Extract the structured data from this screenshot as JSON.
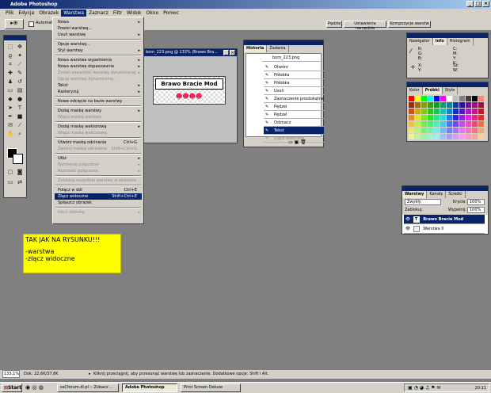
{
  "app": {
    "title": "Adobe Photoshop"
  },
  "menubar": [
    "Plik",
    "Edycja",
    "Obrazek",
    "Warstwa",
    "Zaznacz",
    "Filtr",
    "Widok",
    "Okno",
    "Pomoc"
  ],
  "options": {
    "auto_label": "Automaty",
    "palette_buttons": [
      "Pędzle",
      "Ustawienia narzędzia",
      "Kompozycje warstw"
    ]
  },
  "menu": [
    {
      "label": "Nowa",
      "arrow": "▸",
      "state": "normal"
    },
    {
      "label": "Powiel warstwę...",
      "state": "normal"
    },
    {
      "label": "Usuń warstwę",
      "arrow": "▸",
      "state": "normal"
    },
    {
      "sep": true
    },
    {
      "label": "Opcje warstwy...",
      "state": "normal"
    },
    {
      "label": "Styl warstwy",
      "arrow": "▸",
      "state": "normal"
    },
    {
      "sep": true
    },
    {
      "label": "Nowa warstwa wypełnienia",
      "arrow": "▸",
      "state": "normal"
    },
    {
      "label": "Nowa warstwa dopasowania",
      "arrow": "▸",
      "state": "normal"
    },
    {
      "label": "Zmień zawartość warstwy dynamicznej",
      "arrow": "▸",
      "state": "disabled"
    },
    {
      "label": "Opcje warstwy dynamicznej...",
      "state": "disabled"
    },
    {
      "label": "Tekst",
      "arrow": "▸",
      "state": "normal"
    },
    {
      "label": "Rasteryzuj",
      "arrow": "▸",
      "state": "normal"
    },
    {
      "sep": true
    },
    {
      "label": "Nowe odcięcie na bazie warstwy",
      "state": "normal"
    },
    {
      "sep": true
    },
    {
      "label": "Dodaj maskę warstwy",
      "arrow": "▸",
      "state": "normal"
    },
    {
      "label": "Włącz maskę warstwy",
      "state": "disabled"
    },
    {
      "sep": true
    },
    {
      "label": "Dodaj maskę wektorową",
      "arrow": "▸",
      "state": "normal"
    },
    {
      "label": "Włącz maskę wektorową",
      "state": "disabled"
    },
    {
      "sep": true
    },
    {
      "label": "Utwórz maskę odcinania",
      "shortcut": "Ctrl+G",
      "state": "normal"
    },
    {
      "label": "Zwolnij maskę odcinania",
      "shortcut": "Shift+Ctrl+G",
      "state": "disabled"
    },
    {
      "sep": true
    },
    {
      "label": "Ułóż",
      "arrow": "▸",
      "state": "normal"
    },
    {
      "label": "Wyrównaj połączone",
      "arrow": "▸",
      "state": "disabled"
    },
    {
      "label": "Rozmieść połączone",
      "arrow": "▸",
      "state": "disabled"
    },
    {
      "sep": true
    },
    {
      "label": "Zablokuj wszystkie warstwy w zestawie...",
      "state": "disabled"
    },
    {
      "sep": true
    },
    {
      "label": "Połącz w dół",
      "shortcut": "Ctrl+E",
      "state": "normal"
    },
    {
      "label": "Złącz widoczne",
      "shortcut": "Shift+Ctrl+E",
      "state": "highlight"
    },
    {
      "label": "Spłaszcz obrazek",
      "state": "normal"
    },
    {
      "sep": true
    },
    {
      "label": "Usuń otoczkę",
      "arrow": "▸",
      "state": "disabled"
    }
  ],
  "document": {
    "title": "bom_223.png @ 133% (Brawo Bra...",
    "banner": "Brawo Bracie Mod"
  },
  "history": {
    "tabs": [
      "Historia",
      "Zadania"
    ],
    "snapshot": "bom_223.png",
    "rows": [
      {
        "label": "Otwórz",
        "state": "normal"
      },
      {
        "label": "Półobka",
        "state": "normal"
      },
      {
        "label": "Półobka",
        "state": "normal"
      },
      {
        "label": "Usuń",
        "state": "normal"
      },
      {
        "label": "Zaznaczenie prostokątne",
        "state": "normal"
      },
      {
        "label": "Pędzel",
        "state": "normal"
      },
      {
        "label": "Pędzel",
        "state": "normal"
      },
      {
        "label": "Odznacz",
        "state": "normal"
      },
      {
        "label": "Tekst",
        "state": "selected"
      },
      {
        "label": "Złącz widoczne",
        "state": "disabled"
      }
    ]
  },
  "navigator": {
    "tabs": [
      "Nawigator",
      "Info",
      "Histogram"
    ],
    "labels": [
      "R:",
      "G:",
      "B:",
      "C:",
      "M:",
      "Y:",
      "K:",
      "X:",
      "Y:",
      "Sz:",
      "W:"
    ]
  },
  "swatches": {
    "tabs": [
      "Kolor",
      "Próbki",
      "Style"
    ]
  },
  "layers": {
    "tabs": [
      "Warstwy",
      "Kanały",
      "Ścieżki"
    ],
    "blend": "Zwykły",
    "opacity_label": "Krycie:",
    "opacity": "100%",
    "lock_label": "Zablokuj:",
    "fill_label": "Wypełnij:",
    "fill": "100%",
    "items": [
      {
        "name": "Brawo Bracie Mod",
        "selected": true
      },
      {
        "name": "Warstwa 0",
        "selected": false
      }
    ]
  },
  "note": {
    "line1": "TAK JAK NA RYSUNKU!!!",
    "line2": "-warstwa",
    "line3": "-złącz widoczne"
  },
  "status": {
    "zoom": "133,1%",
    "doc": "Dok: 22,6K/37,6K",
    "hint": "Kliknij przeciągnij, aby przesunąć warstwę lub zaznaczenie. Dodatkowe opcje: Shift i Alt."
  },
  "taskbar": {
    "start": "Start",
    "tasks": [
      "ssCforum.dl.pl :: Zobacz ...",
      "Adobe Photoshop",
      "Print Screen Deluxe"
    ],
    "clock": "20:11"
  }
}
